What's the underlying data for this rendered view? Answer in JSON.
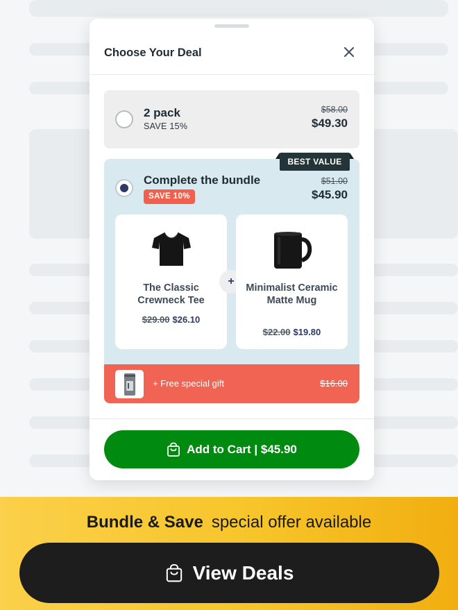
{
  "modal": {
    "title": "Choose Your Deal",
    "option_two_pack": {
      "title": "2 pack",
      "subtitle": "SAVE 15%",
      "old_price": "$58.00",
      "new_price": "$49.30",
      "selected": false
    },
    "option_bundle": {
      "title": "Complete the bundle",
      "badge": "SAVE 10%",
      "ribbon": "BEST VALUE",
      "old_price": "$51.00",
      "new_price": "$45.90",
      "selected": true,
      "products": [
        {
          "name": "The Classic Crewneck Tee",
          "old_price": "$29.00",
          "new_price": "$26.10",
          "icon": "tshirt-icon"
        },
        {
          "name": "Minimalist Ceramic Matte Mug",
          "old_price": "$22.00",
          "new_price": "$19.80",
          "icon": "mug-icon"
        }
      ],
      "plus": "+",
      "gift": {
        "text": "+ Free special gift",
        "old_price": "$16.00",
        "icon": "gift-can-icon"
      }
    },
    "cart_button": {
      "label": "Add to Cart | $45.90",
      "icon": "shopping-bag-icon"
    }
  },
  "banner": {
    "bold_text": "Bundle & Save",
    "text": "special offer available",
    "button_label": "View Deals",
    "button_icon": "shopping-bag-icon"
  },
  "colors": {
    "primary_green": "#008a0f",
    "accent_red": "#f16352",
    "bundle_bg": "#d9e9f0",
    "navy": "#2e3a66",
    "banner_yellow": "#fbd04a",
    "dark_button": "#1d1d1d"
  }
}
